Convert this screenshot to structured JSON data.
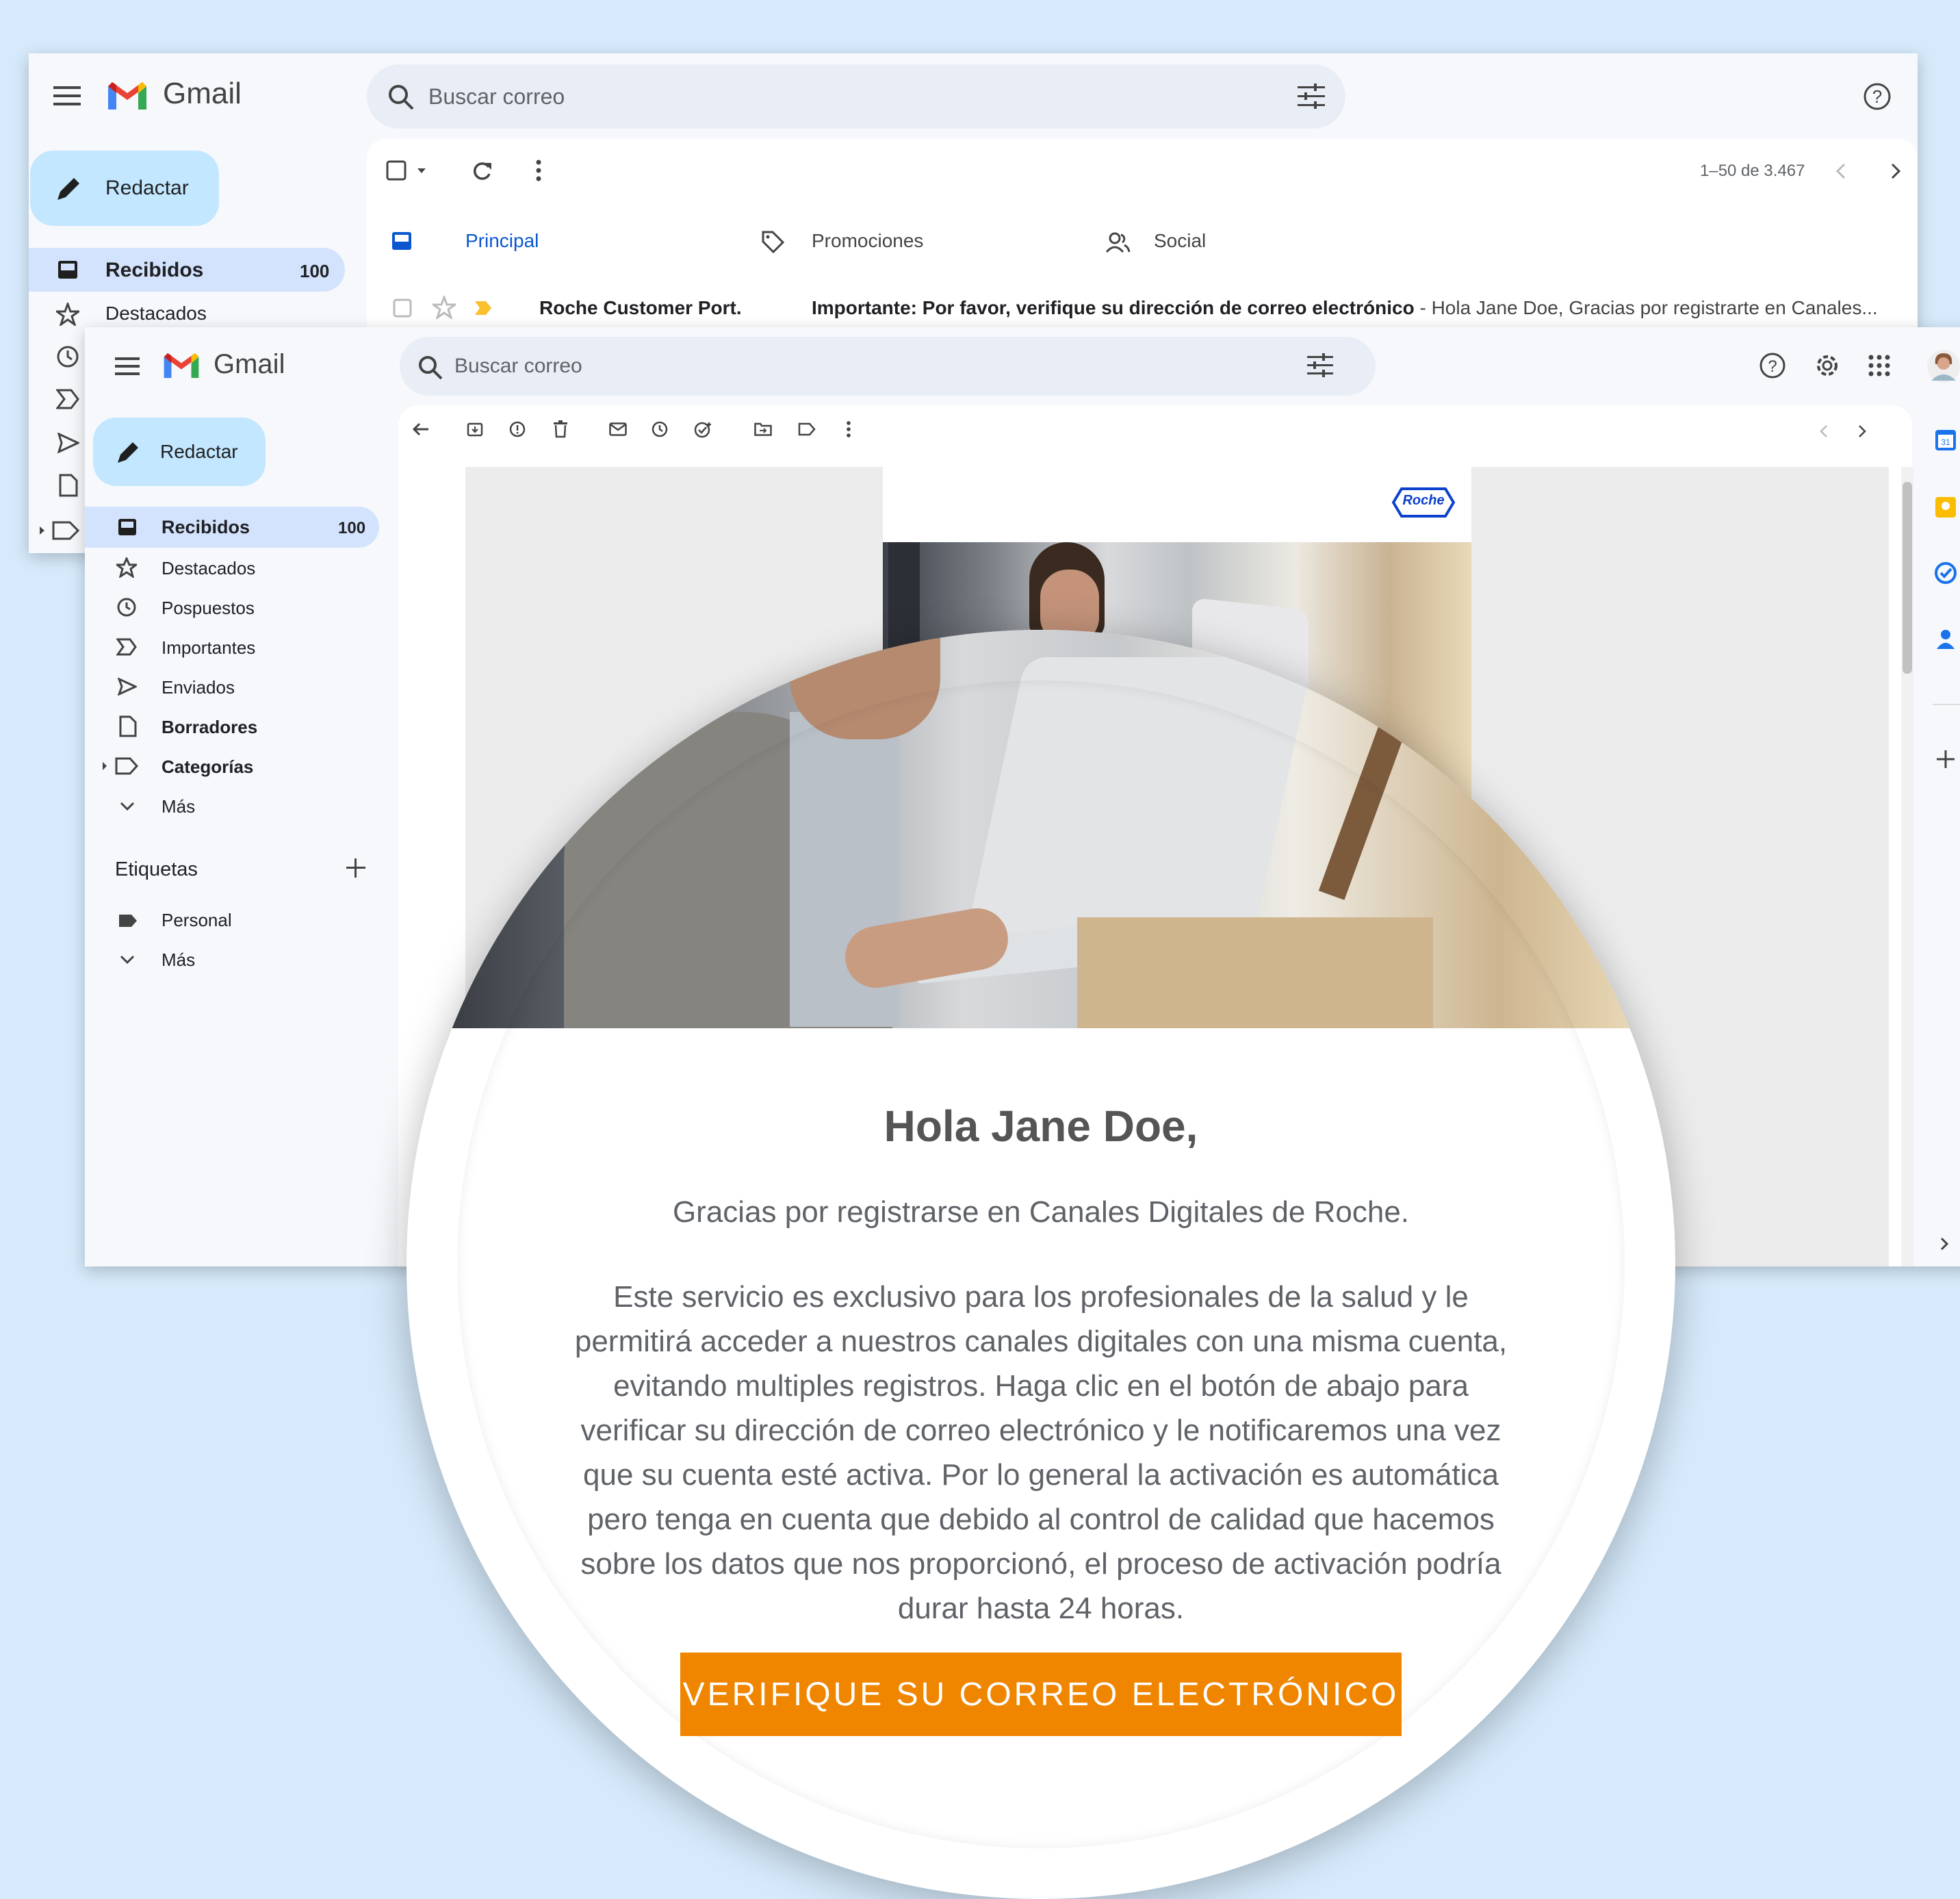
{
  "app": {
    "name": "Gmail"
  },
  "search": {
    "placeholder": "Buscar correo"
  },
  "compose": {
    "label": "Redactar"
  },
  "back_window": {
    "nav": [
      {
        "label": "Recibidos",
        "count": "100"
      },
      {
        "label": "Destacados"
      }
    ],
    "pagination": "1–50 de 3.467",
    "tabs": [
      {
        "label": "Principal",
        "active": true
      },
      {
        "label": "Promociones"
      },
      {
        "label": "Social"
      }
    ],
    "email_row": {
      "sender": "Roche Customer Port.",
      "subject": "Importante: Por favor, verifique su dirección de correo electrónico",
      "snippet": " - Hola Jane Doe, Gracias por registrarte en Canales..."
    }
  },
  "front_window": {
    "nav": [
      {
        "label": "Recibidos",
        "count": "100",
        "bold": true,
        "icon": "inbox-icon"
      },
      {
        "label": "Destacados",
        "icon": "star-icon"
      },
      {
        "label": "Pospuestos",
        "icon": "clock-icon"
      },
      {
        "label": "Importantes",
        "icon": "important-icon"
      },
      {
        "label": "Enviados",
        "icon": "send-icon"
      },
      {
        "label": "Borradores",
        "bold": true,
        "icon": "draft-icon"
      },
      {
        "label": "Categorías",
        "bold": true,
        "icon": "label-icon"
      },
      {
        "label": "Más",
        "icon": "chevron-down-icon"
      }
    ],
    "labels_heading": "Etiquetas",
    "labels": [
      {
        "label": "Personal"
      },
      {
        "label": "Más"
      }
    ],
    "brand_logo_text": "Roche"
  },
  "email": {
    "greeting": "Hola Jane Doe,",
    "intro": "Gracias por registrarse en Canales Digitales de Roche.",
    "body_lines": [
      "Este servicio es exclusivo para los profesionales de la salud y le",
      "permitirá acceder a nuestros canales digitales con una misma cuenta,",
      "evitando multiples registros. Haga clic en el botón de abajo para",
      "verificar su dirección de correo electrónico y le notificaremos una vez",
      "que su cuenta esté activa. Por lo general la activación es automática",
      "pero tenga en cuenta que debido al control de calidad que hacemos",
      "sobre los datos que nos proporcionó, el proceso de activación podría",
      "durar hasta 24 horas."
    ],
    "button_label": "VERIFIQUE SU CORREO ELECTRÓNICO"
  },
  "colors": {
    "background": "#d6eafb",
    "gmail_blue": "#0b57d0",
    "selected_nav": "#d3e3fd",
    "compose_bg": "#c2e7ff",
    "cta_orange": "#f08500",
    "roche_blue": "#0b41cd"
  }
}
